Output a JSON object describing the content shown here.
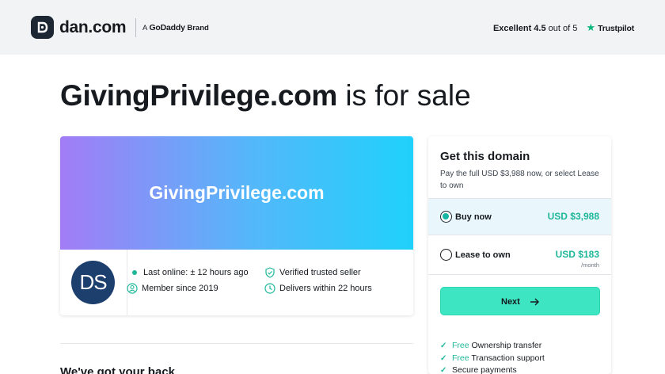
{
  "header": {
    "logo_text": "dan.com",
    "brand_prefix": "A",
    "brand_name": "GoDaddy",
    "brand_suffix": "Brand",
    "rating_label": "Excellent 4.5",
    "rating_scale": "out of 5",
    "trustpilot": "Trustpilot",
    "trustpilot_star": "★",
    "logo_icon": "dan-logo-icon"
  },
  "title": {
    "domain": "GivingPrivilege.com",
    "suffix": "is for sale"
  },
  "listing": {
    "banner_text": "GivingPrivilege.com",
    "avatar_initials": "DS",
    "last_online": "Last online: ± 12 hours ago",
    "member_since": "Member since 2019",
    "verified": "Verified trusted seller",
    "delivers": "Delivers within 22 hours",
    "icons": {
      "online": "online-dot-icon",
      "member": "user-icon",
      "verified": "shield-check-icon",
      "delivers": "clock-icon"
    }
  },
  "purchase": {
    "title": "Get this domain",
    "subtitle": "Pay the full USD $3,988 now, or select Lease to own",
    "buy_label": "Buy now",
    "buy_price": "USD $3,988",
    "buy_selected": true,
    "lease_label": "Lease to own",
    "lease_price": "USD $183",
    "lease_unit": "/month",
    "next_label": "Next",
    "perks": [
      {
        "free": "Free",
        "text": "Ownership transfer"
      },
      {
        "free": "Free",
        "text": "Transaction support"
      },
      {
        "free": "",
        "text": "Secure payments"
      }
    ],
    "accent": "#1fb79a",
    "button_color": "#3de5c3"
  },
  "section": {
    "back_title": "We've got your back"
  }
}
